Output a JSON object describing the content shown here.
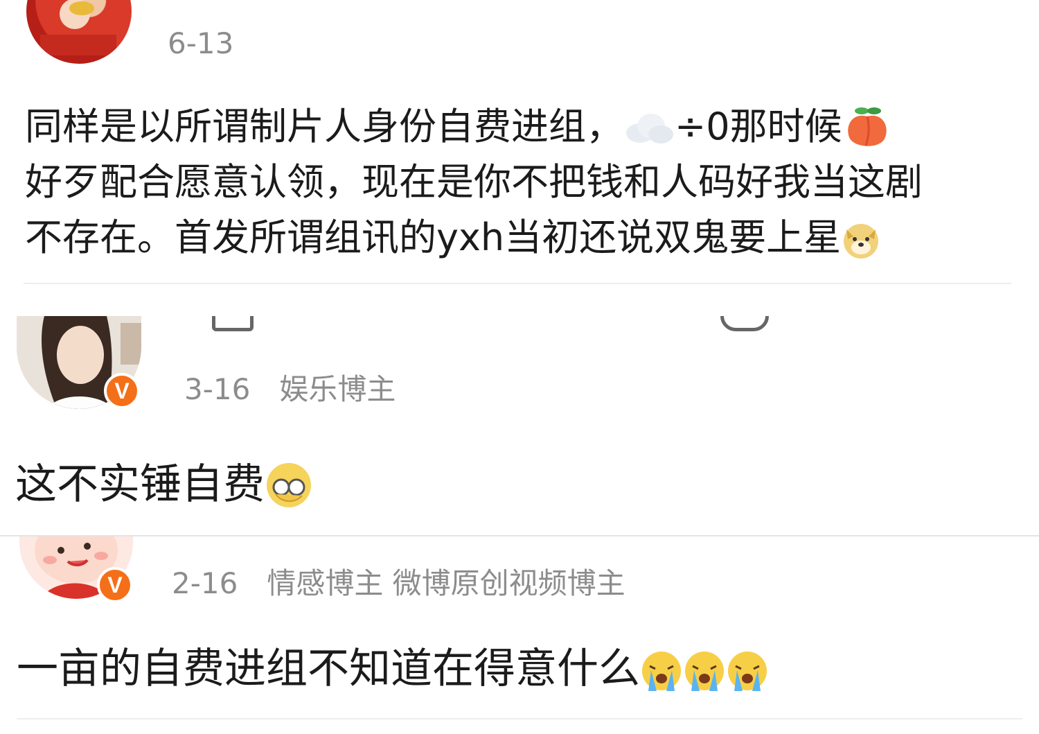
{
  "comments": [
    {
      "date": "6-13",
      "tags": "",
      "text_line1": "同样是以所谓制片人身份自费进组，",
      "text_line1b": "÷0那时候",
      "text_line2": "好歹配合愿意认领，现在是你不把钱和人码好我当这剧",
      "text_line3": "不存在。首发所谓组讯的yxh当初还说双鬼要上星",
      "emoji_names": [
        "cloud-emoji",
        "peach-emoji",
        "doge-emoji"
      ]
    },
    {
      "date": "3-16",
      "tags": "娱乐博主",
      "badge": "V",
      "text": "这不实锤自费",
      "emoji_names": [
        "facepalm-emoji"
      ]
    },
    {
      "date": "2-16",
      "tags": "情感博主 微博原创视频博主",
      "badge": "V",
      "text": "一亩的自费进组不知道在得意什么",
      "emoji_names": [
        "crying-emoji",
        "crying-emoji",
        "crying-emoji"
      ]
    }
  ],
  "colors": {
    "accent": "#f46f17",
    "meta_gray": "#8c8c8c",
    "username_orange": "#f47a1c"
  }
}
